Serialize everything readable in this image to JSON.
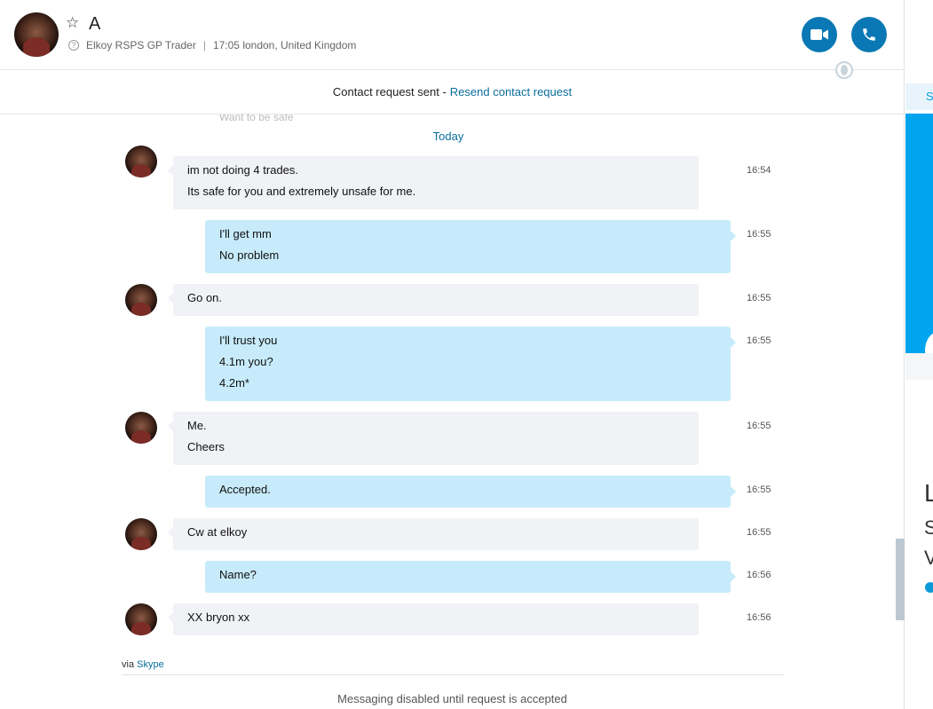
{
  "header": {
    "contact_name": "A",
    "subtitle": "Elkoy RSPS GP Trader",
    "location": "17:05 london, United Kingdom",
    "icons": {
      "star": "star-icon",
      "help": "help-circle-icon",
      "video": "video-call-icon",
      "call": "phone-icon",
      "globe": "globe-icon"
    }
  },
  "request_bar": {
    "text": "Contact request sent -",
    "link": "Resend contact request"
  },
  "conversation": {
    "ghost_text": "Want to be safe",
    "day_label": "Today",
    "messages": [
      {
        "from": "them",
        "lines": [
          "im not doing 4 trades.",
          "Its safe for you and extremely unsafe for me."
        ],
        "time": "16:54"
      },
      {
        "from": "me",
        "lines": [
          "I'll get mm",
          "No problem"
        ],
        "time": "16:55"
      },
      {
        "from": "them",
        "lines": [
          "Go on."
        ],
        "time": "16:55"
      },
      {
        "from": "me",
        "lines": [
          "I'll trust you",
          "4.1m you?",
          "4.2m*"
        ],
        "time": "16:55"
      },
      {
        "from": "them",
        "lines": [
          "Me.",
          "Cheers"
        ],
        "time": "16:55"
      },
      {
        "from": "me",
        "lines": [
          "Accepted."
        ],
        "time": "16:55"
      },
      {
        "from": "them",
        "lines": [
          "Cw at elkoy"
        ],
        "time": "16:55"
      },
      {
        "from": "me",
        "lines": [
          "Name?"
        ],
        "time": "16:56"
      },
      {
        "from": "them",
        "lines": [
          "XX bryon xx"
        ],
        "time": "16:56"
      }
    ]
  },
  "footer": {
    "via_text": "via",
    "via_link": "Skype",
    "disabled_note": "Messaging disabled until request is accepted"
  },
  "side_panel": {
    "tab_letter": "S",
    "letters": [
      "L",
      "S",
      "V"
    ]
  },
  "colors": {
    "accent": "#0a78b4",
    "link": "#0a6e9c",
    "outgoing_bubble": "#c7ebfa",
    "incoming_bubble": "#f0f2f5",
    "skype_blue": "#00a4ef"
  }
}
